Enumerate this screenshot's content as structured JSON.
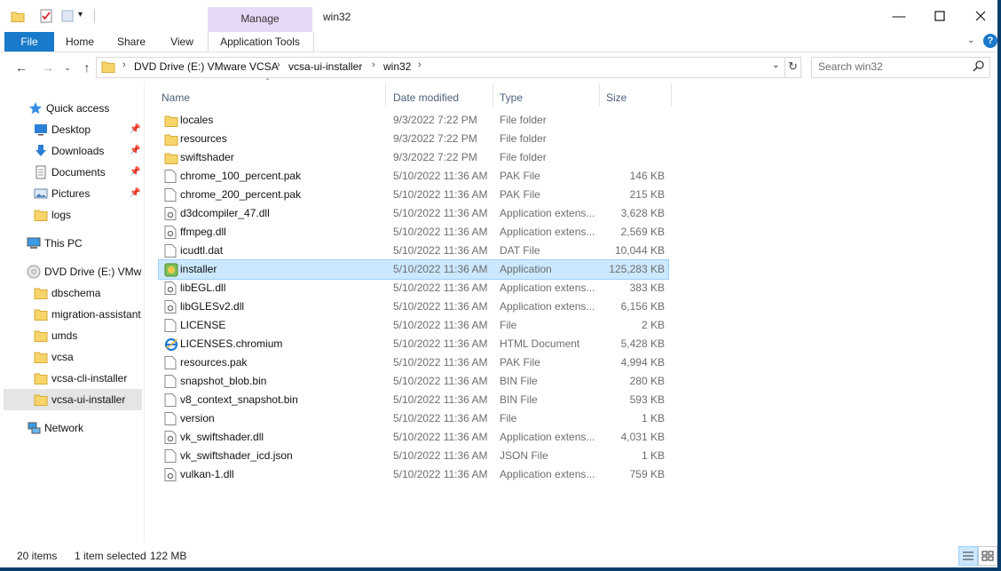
{
  "window": {
    "title": "win32",
    "manage_label": "Manage"
  },
  "ribbon": {
    "tabs": [
      "File",
      "Home",
      "Share",
      "View",
      "Application Tools"
    ]
  },
  "address": {
    "crumbs": [
      "DVD Drive (E:) VMware VCSA",
      "vcsa-ui-installer",
      "win32"
    ],
    "search_placeholder": "Search win32"
  },
  "nav": {
    "items": [
      {
        "label": "Quick access",
        "icon": "star-icon"
      },
      {
        "label": "Desktop",
        "icon": "desktop-icon",
        "pinned": true
      },
      {
        "label": "Downloads",
        "icon": "download-arrow-icon",
        "pinned": true
      },
      {
        "label": "Documents",
        "icon": "documents-icon",
        "pinned": true
      },
      {
        "label": "Pictures",
        "icon": "pictures-icon",
        "pinned": true
      },
      {
        "label": "logs",
        "icon": "folder-icon"
      },
      {
        "label": "This PC",
        "icon": "computer-icon"
      },
      {
        "label": "DVD Drive (E:) VMwa",
        "icon": "dvd-drive-icon"
      },
      {
        "label": "dbschema",
        "icon": "folder-icon"
      },
      {
        "label": "migration-assistant",
        "icon": "folder-icon"
      },
      {
        "label": "umds",
        "icon": "folder-icon"
      },
      {
        "label": "vcsa",
        "icon": "folder-icon"
      },
      {
        "label": "vcsa-cli-installer",
        "icon": "folder-icon"
      },
      {
        "label": "vcsa-ui-installer",
        "icon": "folder-icon",
        "selected": true
      },
      {
        "label": "Network",
        "icon": "network-icon"
      }
    ]
  },
  "columns": {
    "name": "Name",
    "date": "Date modified",
    "type": "Type",
    "size": "Size"
  },
  "files": [
    {
      "name": "locales",
      "date": "9/3/2022 7:22 PM",
      "type": "File folder",
      "size": "",
      "icon": "folder-icon"
    },
    {
      "name": "resources",
      "date": "9/3/2022 7:22 PM",
      "type": "File folder",
      "size": "",
      "icon": "folder-icon"
    },
    {
      "name": "swiftshader",
      "date": "9/3/2022 7:22 PM",
      "type": "File folder",
      "size": "",
      "icon": "folder-icon"
    },
    {
      "name": "chrome_100_percent.pak",
      "date": "5/10/2022 11:36 AM",
      "type": "PAK File",
      "size": "146 KB",
      "icon": "file-icon"
    },
    {
      "name": "chrome_200_percent.pak",
      "date": "5/10/2022 11:36 AM",
      "type": "PAK File",
      "size": "215 KB",
      "icon": "file-icon"
    },
    {
      "name": "d3dcompiler_47.dll",
      "date": "5/10/2022 11:36 AM",
      "type": "Application extens...",
      "size": "3,628 KB",
      "icon": "dll-icon"
    },
    {
      "name": "ffmpeg.dll",
      "date": "5/10/2022 11:36 AM",
      "type": "Application extens...",
      "size": "2,569 KB",
      "icon": "dll-icon"
    },
    {
      "name": "icudtl.dat",
      "date": "5/10/2022 11:36 AM",
      "type": "DAT File",
      "size": "10,044 KB",
      "icon": "file-icon"
    },
    {
      "name": "installer",
      "date": "5/10/2022 11:36 AM",
      "type": "Application",
      "size": "125,283 KB",
      "icon": "application-icon",
      "selected": true
    },
    {
      "name": "libEGL.dll",
      "date": "5/10/2022 11:36 AM",
      "type": "Application extens...",
      "size": "383 KB",
      "icon": "dll-icon"
    },
    {
      "name": "libGLESv2.dll",
      "date": "5/10/2022 11:36 AM",
      "type": "Application extens...",
      "size": "6,156 KB",
      "icon": "dll-icon"
    },
    {
      "name": "LICENSE",
      "date": "5/10/2022 11:36 AM",
      "type": "File",
      "size": "2 KB",
      "icon": "file-icon"
    },
    {
      "name": "LICENSES.chromium",
      "date": "5/10/2022 11:36 AM",
      "type": "HTML Document",
      "size": "5,428 KB",
      "icon": "ie-html-icon"
    },
    {
      "name": "resources.pak",
      "date": "5/10/2022 11:36 AM",
      "type": "PAK File",
      "size": "4,994 KB",
      "icon": "file-icon"
    },
    {
      "name": "snapshot_blob.bin",
      "date": "5/10/2022 11:36 AM",
      "type": "BIN File",
      "size": "280 KB",
      "icon": "file-icon"
    },
    {
      "name": "v8_context_snapshot.bin",
      "date": "5/10/2022 11:36 AM",
      "type": "BIN File",
      "size": "593 KB",
      "icon": "file-icon"
    },
    {
      "name": "version",
      "date": "5/10/2022 11:36 AM",
      "type": "File",
      "size": "1 KB",
      "icon": "file-icon"
    },
    {
      "name": "vk_swiftshader.dll",
      "date": "5/10/2022 11:36 AM",
      "type": "Application extens...",
      "size": "4,031 KB",
      "icon": "dll-icon"
    },
    {
      "name": "vk_swiftshader_icd.json",
      "date": "5/10/2022 11:36 AM",
      "type": "JSON File",
      "size": "1 KB",
      "icon": "file-icon"
    },
    {
      "name": "vulkan-1.dll",
      "date": "5/10/2022 11:36 AM",
      "type": "Application extens...",
      "size": "759 KB",
      "icon": "dll-icon"
    }
  ],
  "status": {
    "count": "20 items",
    "selection": "1 item selected",
    "size": "122 MB"
  },
  "colors": {
    "file_tab": "#1979ca",
    "manage_bg": "#e8d8f8",
    "selection_bg": "#cce8ff",
    "selection_border": "#99d1ff",
    "folder_yellow": "#f7d56b"
  }
}
